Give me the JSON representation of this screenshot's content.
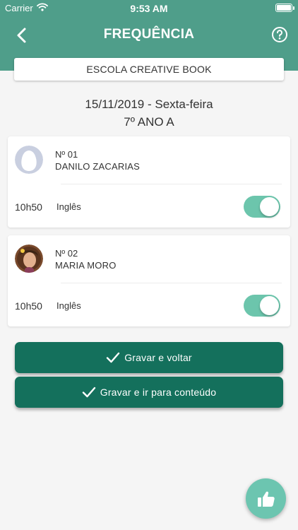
{
  "status_bar": {
    "carrier": "Carrier",
    "time": "9:53 AM"
  },
  "header": {
    "title": "FREQUÊNCIA"
  },
  "school": {
    "name": "ESCOLA CREATIVE BOOK"
  },
  "session": {
    "date": "15/11/2019 - Sexta-feira",
    "class": "7º ANO A"
  },
  "students": [
    {
      "number": "Nº 01",
      "name": "DANILO ZACARIAS",
      "time": "10h50",
      "subject": "Inglês",
      "present": true
    },
    {
      "number": "Nº 02",
      "name": "MARIA MORO",
      "time": "10h50",
      "subject": "Inglês",
      "present": true
    }
  ],
  "actions": {
    "save_back": "Gravar e voltar",
    "save_content": "Gravar e ir para conteúdo"
  },
  "colors": {
    "header": "#4f9e8a",
    "button": "#14705c",
    "toggle_on": "#6cc5ac",
    "fab": "#6cc5b0"
  },
  "icons": [
    "back-arrow-icon",
    "help-icon",
    "wifi-icon",
    "battery-icon",
    "check-icon",
    "thumbs-up-icon"
  ]
}
